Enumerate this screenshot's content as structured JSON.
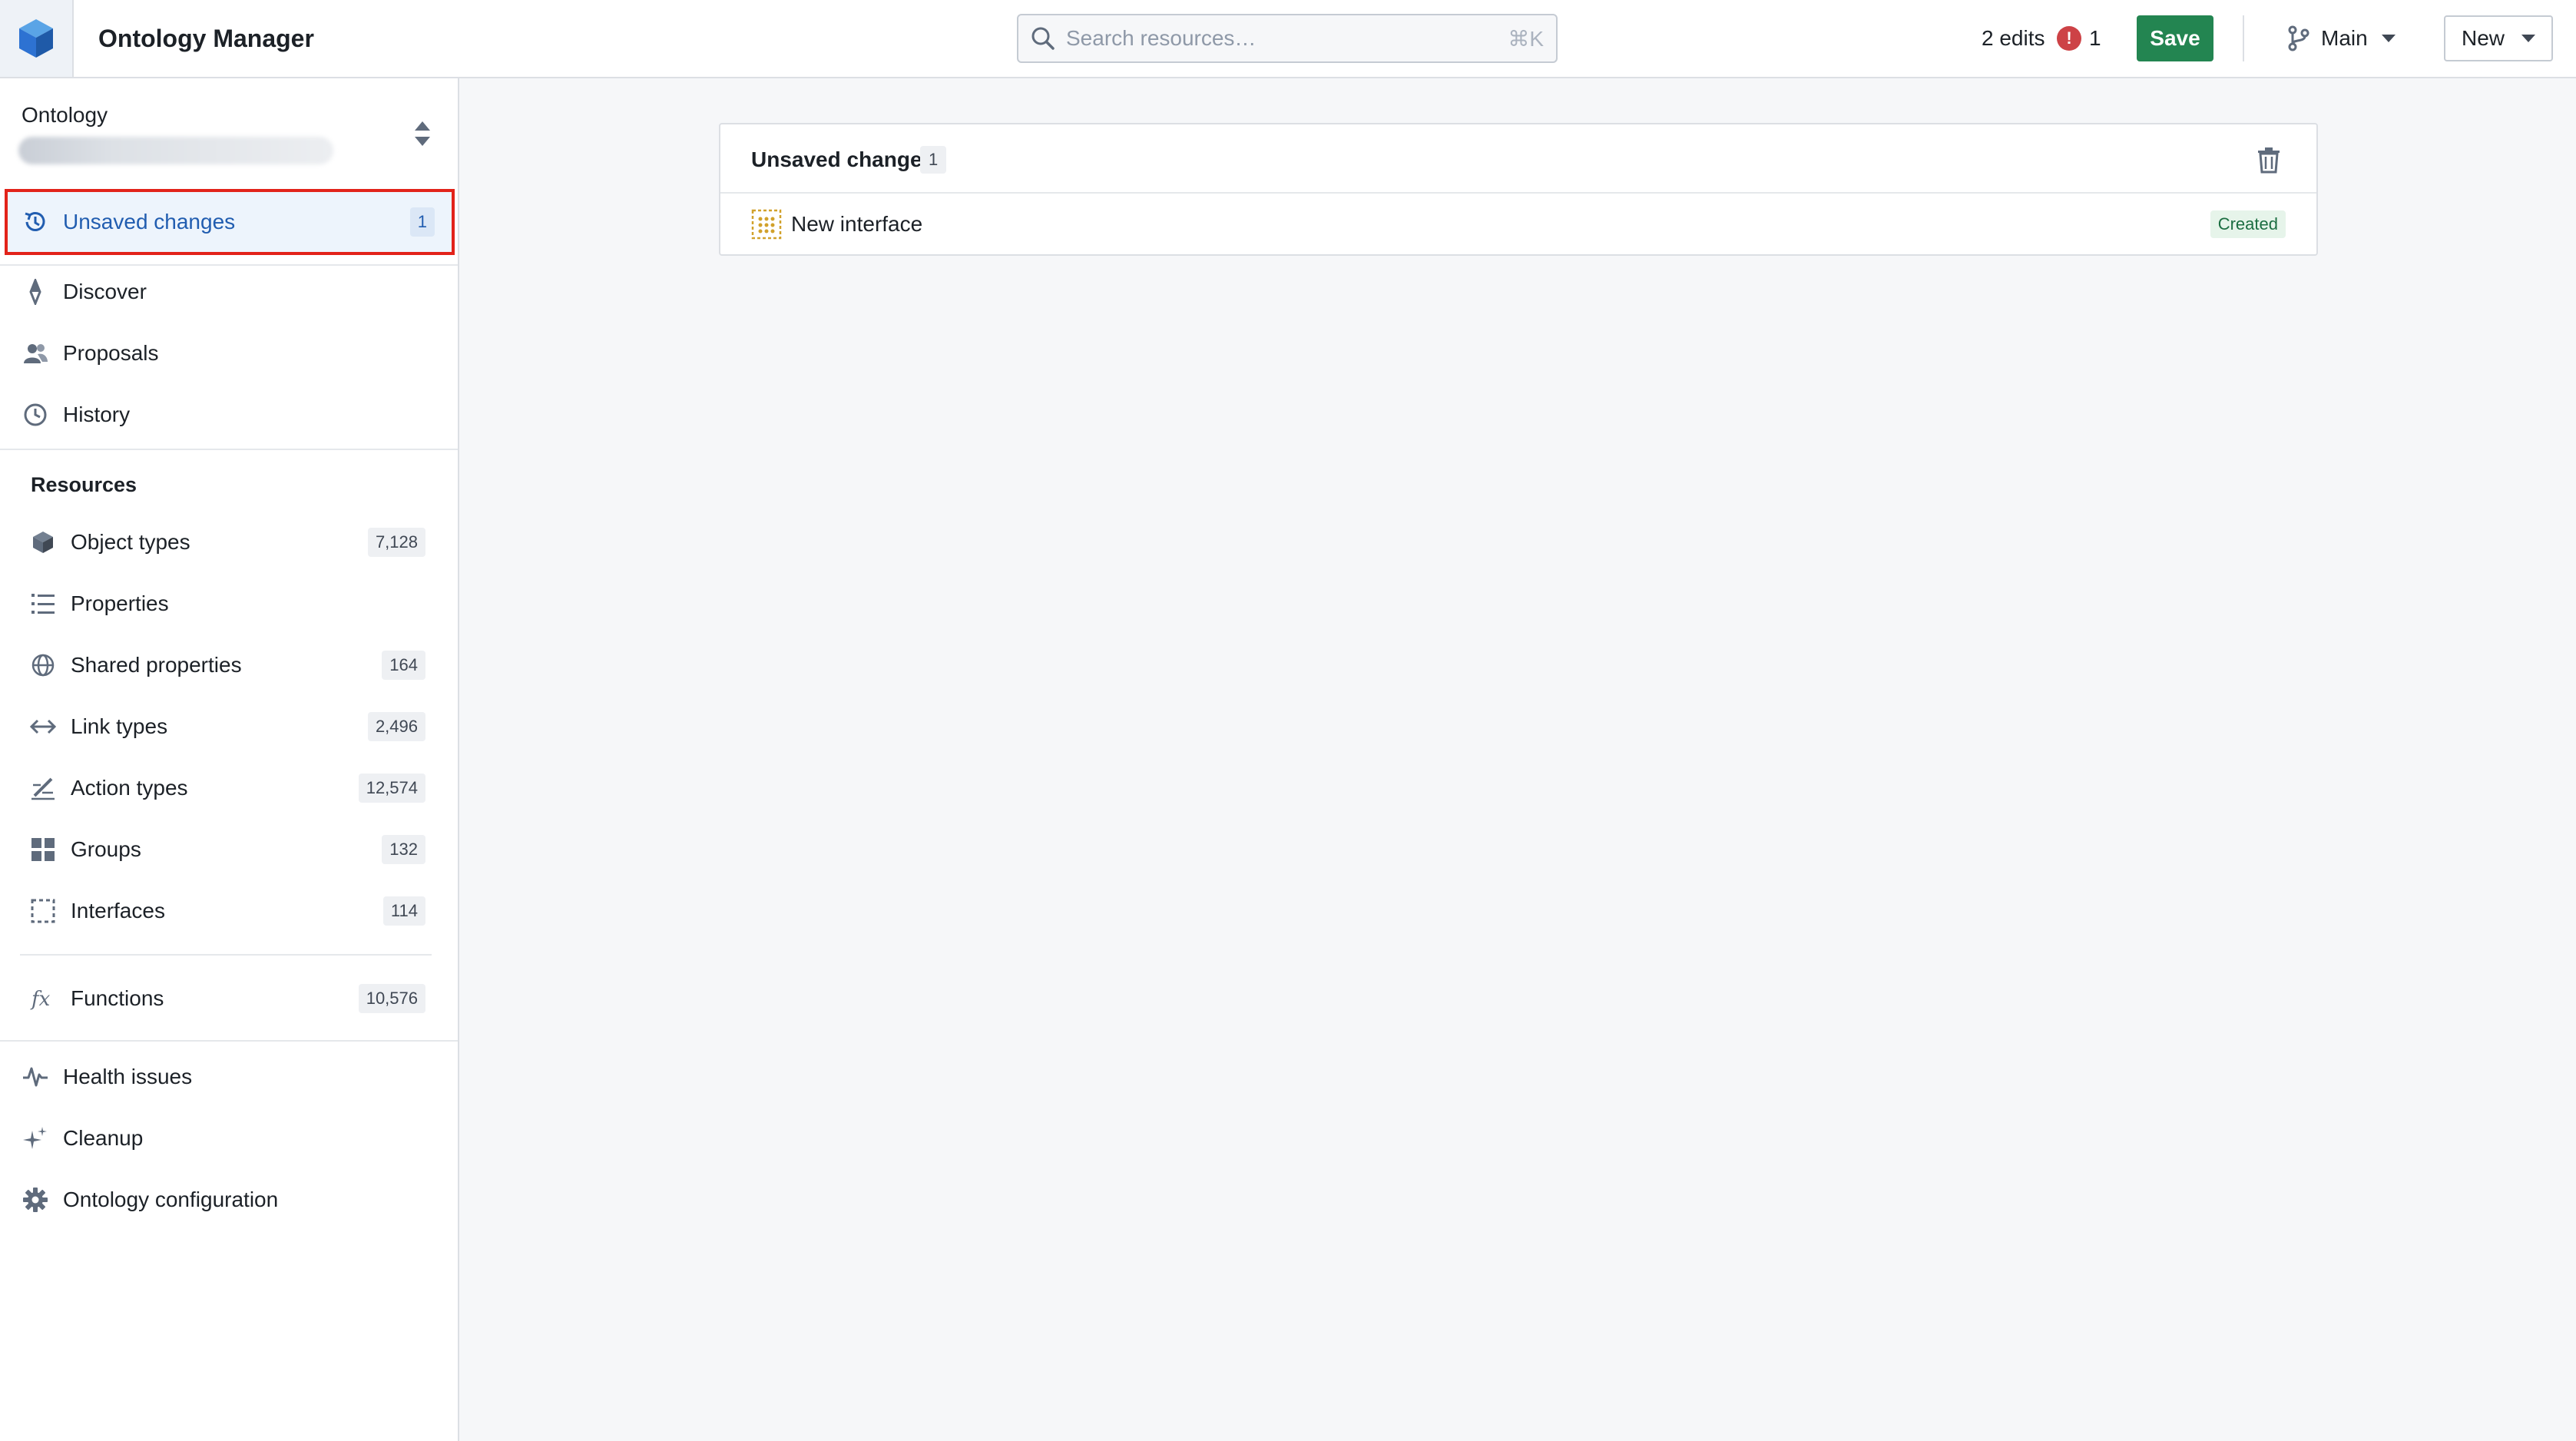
{
  "header": {
    "app_title": "Ontology Manager",
    "search_placeholder": "Search resources…",
    "search_hotkey": "⌘K",
    "edits_label": "2 edits",
    "error_count": "1",
    "save_label": "Save",
    "branch_label": "Main",
    "new_label": "New"
  },
  "sidebar": {
    "ontology_label": "Ontology",
    "top_items": [
      {
        "label": "Unsaved changes",
        "count": "1",
        "icon": "history-changes-icon"
      },
      {
        "label": "Discover",
        "icon": "compass-icon"
      },
      {
        "label": "Proposals",
        "icon": "people-icon"
      },
      {
        "label": "History",
        "icon": "clock-icon"
      }
    ],
    "resources_title": "Resources",
    "resources": [
      {
        "label": "Object types",
        "count": "7,128",
        "icon": "cube-icon"
      },
      {
        "label": "Properties",
        "count": "",
        "icon": "list-icon"
      },
      {
        "label": "Shared properties",
        "count": "164",
        "icon": "globe-icon"
      },
      {
        "label": "Link types",
        "count": "2,496",
        "icon": "arrows-horizontal-icon"
      },
      {
        "label": "Action types",
        "count": "12,574",
        "icon": "edit-action-icon"
      },
      {
        "label": "Groups",
        "count": "132",
        "icon": "grid-icon"
      },
      {
        "label": "Interfaces",
        "count": "114",
        "icon": "dashed-square-icon"
      },
      {
        "label": "Functions",
        "count": "10,576",
        "icon": "function-icon"
      }
    ],
    "bottom_items": [
      {
        "label": "Health issues",
        "icon": "pulse-icon"
      },
      {
        "label": "Cleanup",
        "icon": "sparkle-icon"
      },
      {
        "label": "Ontology configuration",
        "icon": "gear-icon"
      }
    ]
  },
  "main": {
    "panel_title": "Unsaved changes",
    "panel_count": "1",
    "changes": [
      {
        "name": "New interface",
        "status": "Created"
      }
    ]
  },
  "colors": {
    "accent_blue": "#215db0",
    "save_green": "#238551",
    "error_red": "#cd4246",
    "highlight_outline": "#e2231a"
  }
}
